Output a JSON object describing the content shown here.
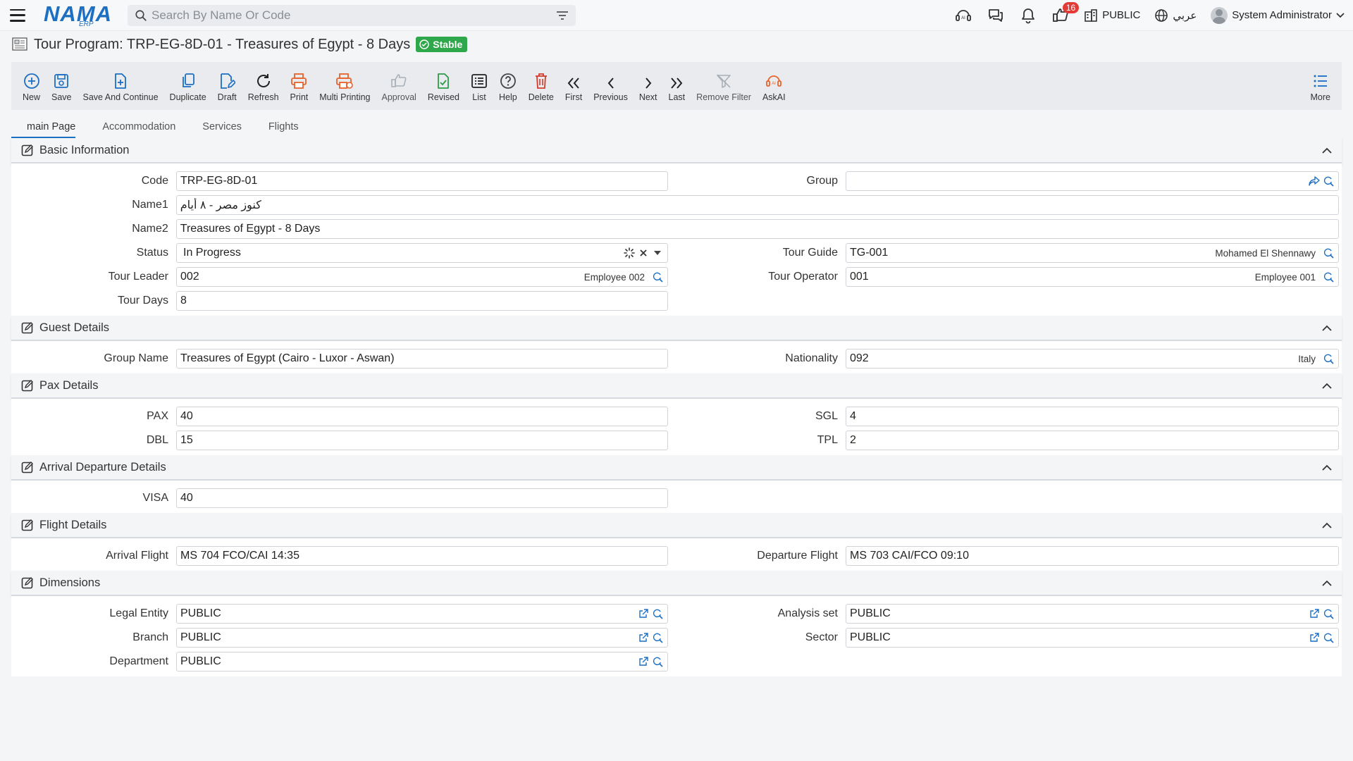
{
  "header": {
    "logo_text": "NAMA",
    "logo_sub": "ERP",
    "search_placeholder": "Search By Name Or Code",
    "notification_count": "16",
    "company": "PUBLIC",
    "language": "عربي",
    "user": "System Administrator"
  },
  "title": {
    "text": "Tour Program: TRP-EG-8D-01 - Treasures of Egypt - 8 Days",
    "status": "Stable"
  },
  "toolbar": {
    "new": "New",
    "save": "Save",
    "save_continue": "Save And Continue",
    "duplicate": "Duplicate",
    "draft": "Draft",
    "refresh": "Refresh",
    "print": "Print",
    "multi_printing": "Multi Printing",
    "approval": "Approval",
    "revised": "Revised",
    "list": "List",
    "help": "Help",
    "delete": "Delete",
    "first": "First",
    "previous": "Previous",
    "next": "Next",
    "last": "Last",
    "remove_filter": "Remove Filter",
    "askai": "AskAI",
    "more": "More"
  },
  "tabs": [
    "main Page",
    "Accommodation",
    "Services",
    "Flights"
  ],
  "sections": {
    "basic": {
      "title": "Basic Information",
      "code_label": "Code",
      "code": "TRP-EG-8D-01",
      "group_label": "Group",
      "group": "",
      "name1_label": "Name1",
      "name1": "كنوز مصر - ٨ أيام",
      "name2_label": "Name2",
      "name2": "Treasures of Egypt - 8 Days",
      "status_label": "Status",
      "status": "In Progress",
      "tour_guide_label": "Tour Guide",
      "tour_guide": "TG-001",
      "tour_guide_name": "Mohamed El Shennawy",
      "tour_leader_label": "Tour Leader",
      "tour_leader": "002",
      "tour_leader_name": "Employee 002",
      "tour_operator_label": "Tour Operator",
      "tour_operator": "001",
      "tour_operator_name": "Employee 001",
      "tour_days_label": "Tour Days",
      "tour_days": "8"
    },
    "guest": {
      "title": "Guest Details",
      "group_name_label": "Group Name",
      "group_name": "Treasures of Egypt (Cairo - Luxor - Aswan)",
      "nationality_label": "Nationality",
      "nationality": "092",
      "nationality_name": "Italy"
    },
    "pax": {
      "title": "Pax Details",
      "pax_label": "PAX",
      "pax": "40",
      "sgl_label": "SGL",
      "sgl": "4",
      "dbl_label": "DBL",
      "dbl": "15",
      "tpl_label": "TPL",
      "tpl": "2"
    },
    "arrival": {
      "title": "Arrival Departure Details",
      "visa_label": "VISA",
      "visa": "40"
    },
    "flight": {
      "title": "Flight Details",
      "arrival_label": "Arrival Flight",
      "arrival": "MS 704 FCO/CAI 14:35",
      "departure_label": "Departure Flight",
      "departure": "MS 703 CAI/FCO 09:10"
    },
    "dimensions": {
      "title": "Dimensions",
      "legal_entity_label": "Legal Entity",
      "legal_entity": "PUBLIC",
      "analysis_set_label": "Analysis set",
      "analysis_set": "PUBLIC",
      "branch_label": "Branch",
      "branch": "PUBLIC",
      "sector_label": "Sector",
      "sector": "PUBLIC",
      "department_label": "Department",
      "department": "PUBLIC"
    }
  },
  "colors": {
    "accent": "#1c6fc2",
    "stable_green": "#2ea84a",
    "orange_icon": "#e8632b",
    "delete_red": "#d33a2c",
    "revised_green": "#2e9b47",
    "badge_red": "#e33b35"
  }
}
